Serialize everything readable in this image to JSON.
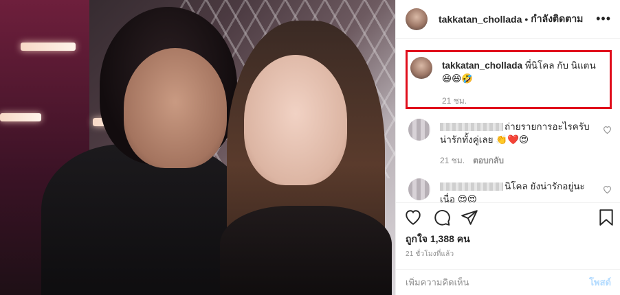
{
  "header": {
    "username": "takkatan_chollada",
    "separator": "•",
    "follow_status": "กำลังติดตาม",
    "more_label": "•••"
  },
  "caption": {
    "username": "takkatan_chollada",
    "text": "พี่นิโคล กับ นิแตน",
    "emojis": "😆😆🤣",
    "time": "21 ชม."
  },
  "comments": [
    {
      "text": "ถ่ายรายการอะไรครับ น่ารักทั้งคู่เลย",
      "emojis": "👏❤️😍",
      "time": "21 ชม.",
      "reply_label": "ตอบกลับ"
    },
    {
      "text": "นิโคล ยังน่ารักอยู่นะ",
      "emojis": "เนื่อ 😍😍",
      "time": "",
      "reply_label": ""
    }
  ],
  "actions": {
    "like_icon": "heart-icon",
    "comment_icon": "comment-icon",
    "share_icon": "share-icon",
    "save_icon": "bookmark-icon"
  },
  "likes": "ถูกใจ 1,388 คน",
  "posted_ago": "21 ชั่วโมงที่แล้ว",
  "add_comment": {
    "placeholder": "เพิ่มความคิดเห็น",
    "post_label": "โพสต์"
  },
  "colors": {
    "highlight_box": "#e00d1b",
    "post_button": "#b3dbff",
    "muted_text": "#8e8e8e"
  }
}
